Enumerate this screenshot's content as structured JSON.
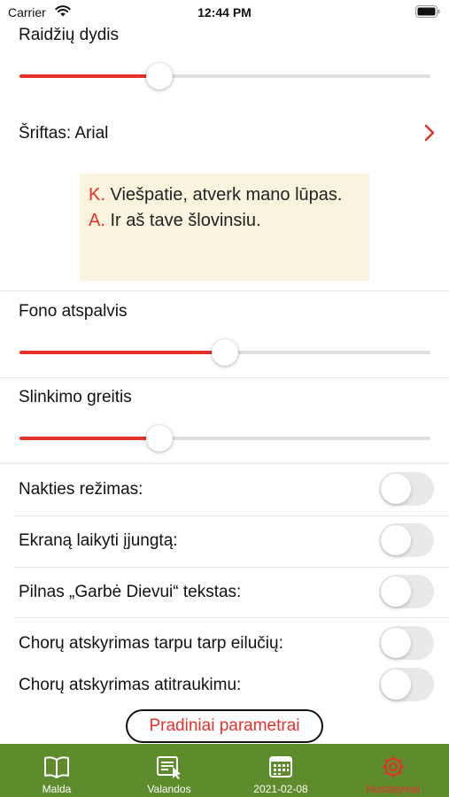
{
  "status_bar": {
    "carrier": "Carrier",
    "time": "12:44 PM"
  },
  "settings": {
    "font_size_label": "Raidžių dydis",
    "font_size_level": 0.34,
    "font_label": "Šriftas: Arial",
    "preview": {
      "line1_marker": "K.",
      "line1_text": " Viešpatie, atverk mano lūpas.",
      "line2_marker": "A.",
      "line2_text": " Ir aš tave šlovinsiu."
    },
    "background_tone_label": "Fono atspalvis",
    "background_tone_level": 0.5,
    "scroll_speed_label": "Slinkimo greitis",
    "scroll_speed_level": 0.34,
    "toggles": [
      {
        "label": "Nakties režimas:",
        "on": false
      },
      {
        "label": "Ekraną laikyti įjungtą:",
        "on": false
      },
      {
        "label": "Pilnas „Garbė Dievui“ tekstas:",
        "on": false
      },
      {
        "label": "Chorų atskyrimas tarpu tarp eilučių:",
        "on": false
      },
      {
        "label": "Chorų atskyrimas atitraukimu:",
        "on": false
      }
    ],
    "reset_label": "Pradiniai parametrai"
  },
  "tab_bar": {
    "tabs": [
      {
        "label": "Malda",
        "icon": "book-icon"
      },
      {
        "label": "Valandos",
        "icon": "hours-list-icon"
      },
      {
        "label": "2021-02-08",
        "icon": "calendar-icon"
      },
      {
        "label": "Nustatymai",
        "icon": "gear-icon"
      }
    ],
    "active_index": 3
  },
  "colors": {
    "accent": "#e8302a",
    "tab_bar_background": "#5e8b2b",
    "preview_background": "#faf3dd"
  }
}
